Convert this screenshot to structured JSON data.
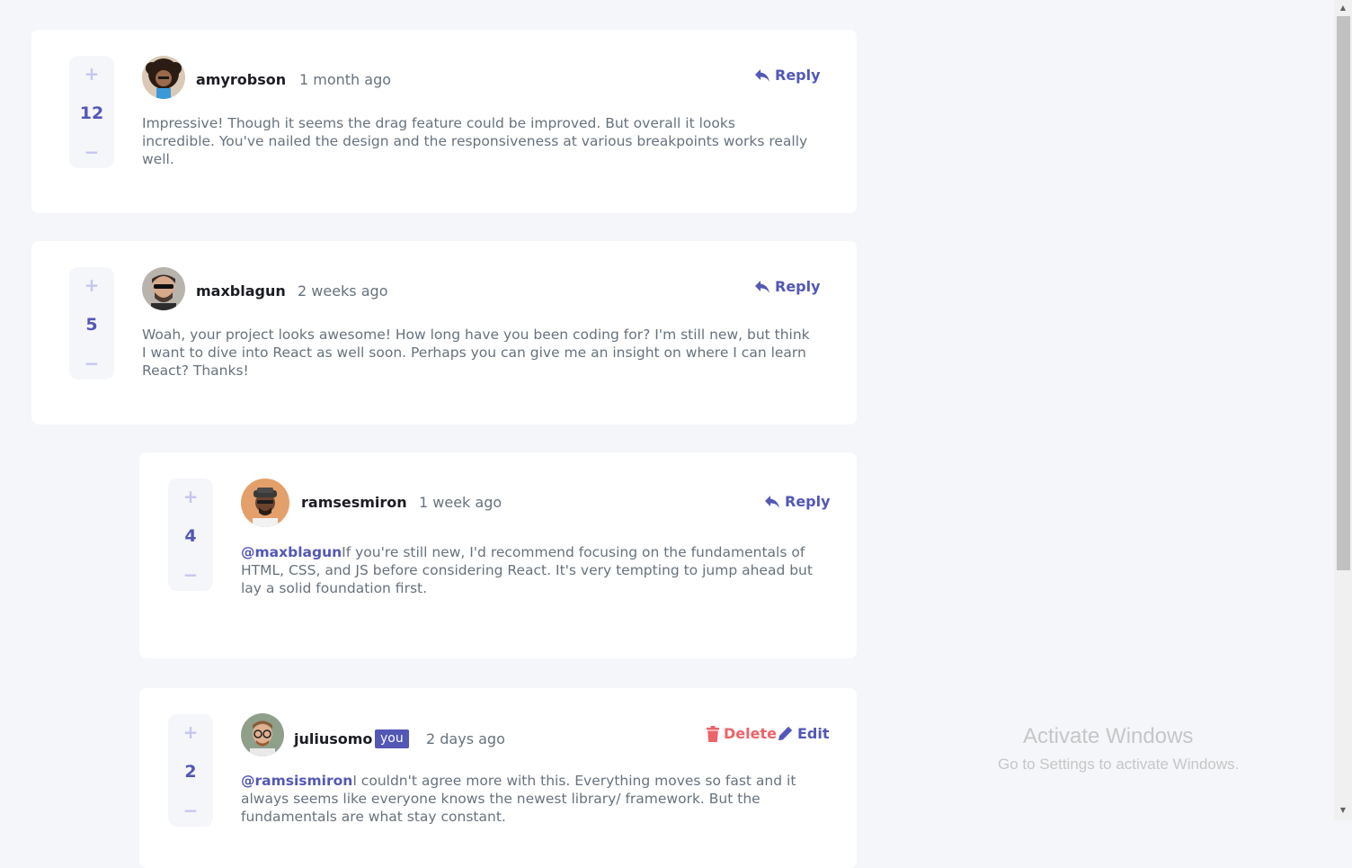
{
  "comments": [
    {
      "username": "amyrobson",
      "time": "1 month ago",
      "score": "12",
      "action": "Reply",
      "content": "Impressive! Though it seems the drag feature could be improved. But overall it looks incredible. You've nailed the design and the responsiveness at various breakpoints works really well."
    },
    {
      "username": "maxblagun",
      "time": "2 weeks ago",
      "score": "5",
      "action": "Reply",
      "content": "Woah, your project looks awesome! How long have you been coding for? I'm still new, but think I want to dive into React as well soon. Perhaps you can give me an insight on where I can learn React? Thanks!"
    }
  ],
  "replies": [
    {
      "username": "ramsesmiron",
      "time": "1 week ago",
      "score": "4",
      "action": "Reply",
      "mention": "@maxblagun",
      "content": "If you're still new, I'd recommend focusing on the fundamentals of HTML, CSS, and JS before considering React. It's very tempting to jump ahead but lay a solid foundation first."
    },
    {
      "username": "juliusomo",
      "badge": "you",
      "time": "2 days ago",
      "score": "2",
      "delete_label": "Delete",
      "edit_label": "Edit",
      "mention": "@ramsismiron",
      "content": "I couldn't agree more with this. Everything moves so fast and it always seems like everyone knows the newest library/ framework. But the fundamentals are what stay constant."
    }
  ],
  "vote_plus": "+",
  "vote_minus": "−",
  "watermark": {
    "title": "Activate Windows",
    "subtitle": "Go to Settings to activate Windows."
  },
  "colors": {
    "background": "#f5f6fa",
    "card": "#ffffff",
    "accent": "#5357b6",
    "vote_light": "#c5c6ef",
    "delete": "#ed6368",
    "text": "#67727e",
    "username": "#1c1d23"
  }
}
